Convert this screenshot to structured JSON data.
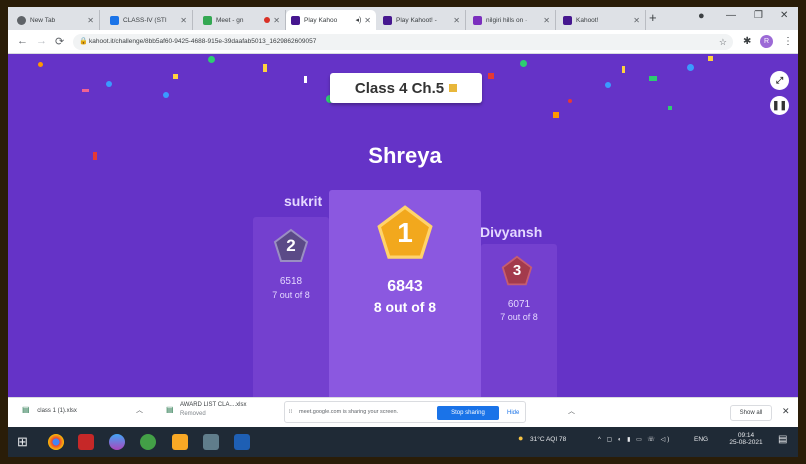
{
  "browser": {
    "tabs": [
      {
        "title": "New Tab",
        "color": "#5f6368"
      },
      {
        "title": "CLASS-IV (STI",
        "color": "#1a73e8"
      },
      {
        "title": "Meet - gn",
        "color": "#34a853"
      },
      {
        "title": "Play Kahoo",
        "color": "#46178f",
        "active": true
      },
      {
        "title": "Play Kahoot! -",
        "color": "#46178f"
      },
      {
        "title": "nilgiri hills on ·",
        "color": "#7b2fbe"
      },
      {
        "title": "Kahoot!",
        "color": "#46178f"
      }
    ],
    "url": "kahoot.it/challenge/8bb5af60-9425-4688-915e-39daafab5013_1629862609057",
    "avatar_letter": "R"
  },
  "kahoot": {
    "quiz_title": "Class 4 Ch.5",
    "winner_name": "Shreya",
    "podium": [
      {
        "rank": "1",
        "name": "",
        "score": "6843",
        "correct": "8 out of 8",
        "badge_color": "#f2a81d"
      },
      {
        "rank": "2",
        "name": "sukrit",
        "score": "6518",
        "correct": "7 out of 8",
        "badge_color": "#5b4a87"
      },
      {
        "rank": "3",
        "name": "Divyansh",
        "score": "6071",
        "correct": "7 out of 8",
        "badge_color": "#a33a4c"
      }
    ]
  },
  "downloads": {
    "item1": "class 1 (1).xlsx",
    "item2_line1": "AWARD LIST CLA....xlsx",
    "item2_line2": "Removed",
    "share_text": "meet.google.com is sharing your screen.",
    "stop_label": "Stop sharing",
    "hide_label": "Hide",
    "show_all_label": "Show all"
  },
  "taskbar": {
    "weather": "31°C AQI 78",
    "lang": "ENG",
    "time": "09:14",
    "date": "25-08-2021"
  }
}
